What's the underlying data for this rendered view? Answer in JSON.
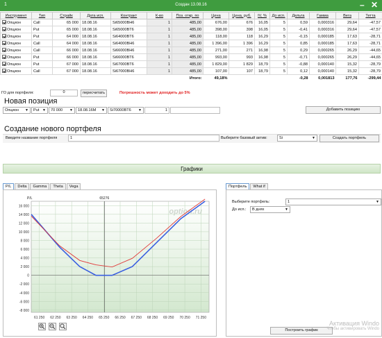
{
  "window": {
    "number": "1",
    "title": "Создан 13.08.16",
    "min": "–",
    "close": "✕"
  },
  "table": {
    "headers": [
      "Инструмент",
      "Тип",
      "Страйк",
      "Дата исп.",
      "Контракт",
      "К-во",
      "Поз. откр. по",
      "Цена",
      "Цена, руб.",
      "IV, %",
      "До исп.",
      "Дельта",
      "Гамма",
      "Вега",
      "Тетта"
    ],
    "rows": [
      [
        "Опцион",
        "Call",
        "65 000",
        "18.08.16",
        "Si65000BH6",
        "1",
        "485,00",
        "676,00",
        "676",
        "16,05",
        "5",
        "0,59",
        "0,000316",
        "29,64",
        "-47,57"
      ],
      [
        "Опцион",
        "Put",
        "65 000",
        "18.08.16",
        "Si65000BT6",
        "1",
        "485,00",
        "398,00",
        "398",
        "16,05",
        "5",
        "-0,41",
        "0,000316",
        "29,64",
        "-47,57"
      ],
      [
        "Опцион",
        "Put",
        "64 000",
        "18.08.16",
        "Si64000BT6",
        "1",
        "485,00",
        "118,00",
        "118",
        "16,29",
        "5",
        "-0,15",
        "0,000185",
        "17,63",
        "-28,71"
      ],
      [
        "Опцион",
        "Call",
        "64 000",
        "18.08.16",
        "Si64000BH6",
        "1",
        "485,00",
        "1 396,00",
        "1 396",
        "16,29",
        "5",
        "0,85",
        "0,000185",
        "17,63",
        "-28,71"
      ],
      [
        "Опцион",
        "Call",
        "66 000",
        "18.08.16",
        "Si66000BH6",
        "1",
        "485,00",
        "271,00",
        "271",
        "16,98",
        "5",
        "0,29",
        "0,000265",
        "26,29",
        "-44,65"
      ],
      [
        "Опцион",
        "Put",
        "66 000",
        "18.08.16",
        "Si66000BT6",
        "1",
        "485,00",
        "993,00",
        "993",
        "16,98",
        "5",
        "-0,71",
        "0,000265",
        "26,29",
        "-44,65"
      ],
      [
        "Опцион",
        "Put",
        "67 000",
        "18.08.16",
        "Si67000BT6",
        "1",
        "485,00",
        "1 829,00",
        "1 829",
        "18,79",
        "5",
        "-0,88",
        "0,000140",
        "15,32",
        "-28,79"
      ],
      [
        "Опцион",
        "Call",
        "67 000",
        "18.08.16",
        "Si67000BH6",
        "1",
        "485,00",
        "107,00",
        "107",
        "18,79",
        "5",
        "0,12",
        "0,000140",
        "15,32",
        "-28,79"
      ]
    ],
    "total_label": "Итого:",
    "total_value": "49,18%",
    "totals": [
      "-0,28",
      "0,001813",
      "177,76",
      "-299,44"
    ]
  },
  "go": {
    "label": "ГО для портфеля:",
    "value": "0",
    "recalc": "пересчитать",
    "warning": "Погрешность может доходить до 5%"
  },
  "new_position": {
    "heading": "Новая позиция",
    "instrument": "Опцион",
    "type": "Put",
    "strike": "70 000",
    "date": "18.08.16M",
    "contract": "Si70000BT6",
    "qty": "1",
    "add_button": "Добавить позицию"
  },
  "new_portfolio": {
    "heading": "Создание нового портфеля",
    "name_label": "Введите название портфеля",
    "name_value": "1",
    "base_label": "Выберите базовый актив:",
    "base_value": "Si",
    "create_button": "Создать портфель"
  },
  "graphs": {
    "heading": "Графики",
    "tabs": [
      "P/L",
      "Delta",
      "Gamma",
      "Theta",
      "Vega"
    ],
    "watermark": "option.ru",
    "zoom_icons": [
      "zoom-in-icon",
      "zoom-out-icon",
      "zoom-reset-icon"
    ]
  },
  "right_panel": {
    "tabs": [
      "Портфель",
      "What if"
    ],
    "portfolio_label": "Выберите портфель:",
    "portfolio_value": "1",
    "expiry_label": "До исп.:",
    "expiry_value": "В днях",
    "build_button": "Построить график"
  },
  "windows_notice": {
    "line1": "Активация Windo",
    "line2": "Чтобы активировать Windo"
  },
  "chart_data": {
    "type": "line",
    "ylabel": "P/L",
    "marker": "65276",
    "x_ticks": [
      "61 250",
      "62 250",
      "63 250",
      "64 250",
      "65 250",
      "66 250",
      "67 250",
      "68 250",
      "69 250",
      "70 250",
      "71 250"
    ],
    "y_ticks": [
      16000,
      14000,
      12000,
      10000,
      8000,
      6000,
      4000,
      2000,
      0,
      -2000,
      -4000,
      -6000,
      -8000
    ],
    "xlim": [
      60750,
      71750
    ],
    "ylim": [
      -8500,
      17000
    ],
    "grid": true,
    "series": [
      {
        "color": "#3a5fe0",
        "x": [
          60750,
          62500,
          63750,
          64750,
          65750,
          67000,
          68500,
          70000,
          71500
        ],
        "y": [
          14000,
          6500,
          2000,
          0,
          0,
          2000,
          7500,
          13000,
          17000
        ]
      },
      {
        "color": "#e03a3a",
        "x": [
          60750,
          62500,
          63750,
          64750,
          65750,
          67000,
          68500,
          70000,
          71500
        ],
        "y": [
          13600,
          6800,
          3400,
          2400,
          1900,
          3900,
          8500,
          13500,
          17500
        ]
      }
    ]
  }
}
